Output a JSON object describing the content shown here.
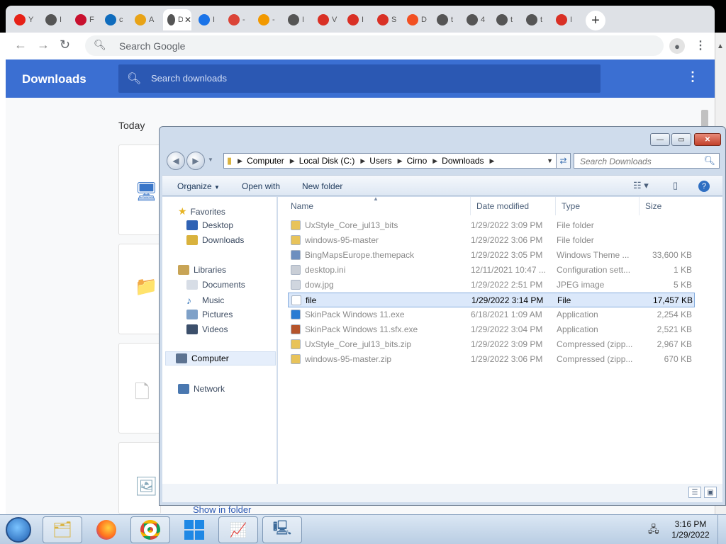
{
  "browser": {
    "tabs": [
      {
        "favicon": "youtube-icon",
        "label": "Y",
        "color": "#e62117"
      },
      {
        "favicon": "globe-icon",
        "label": "I",
        "color": "#555"
      },
      {
        "favicon": "red-logo-icon",
        "label": "F",
        "color": "#c8102e"
      },
      {
        "favicon": "bing-icon",
        "label": "c",
        "color": "#0f6cbd"
      },
      {
        "favicon": "pinwheel-icon",
        "label": "A",
        "color": "#e8a317"
      },
      {
        "favicon": "document-icon",
        "label": "D",
        "color": "#555",
        "active": true
      },
      {
        "favicon": "history-icon",
        "label": "I",
        "color": "#1a73e8"
      },
      {
        "favicon": "chrome-icon",
        "label": "-",
        "color": "#db4437"
      },
      {
        "favicon": "paint-icon",
        "label": "-",
        "color": "#f29900"
      },
      {
        "favicon": "globe-icon",
        "label": "I",
        "color": "#555"
      },
      {
        "favicon": "grid-icon",
        "label": "V",
        "color": "#d93025"
      },
      {
        "favicon": "target-icon",
        "label": "I",
        "color": "#d93025"
      },
      {
        "favicon": "grid-icon",
        "label": "S",
        "color": "#d93025"
      },
      {
        "favicon": "windows-icon",
        "label": "D",
        "color": "#f25022"
      },
      {
        "favicon": "globe-icon",
        "label": "t",
        "color": "#555"
      },
      {
        "favicon": "globe-icon",
        "label": "4",
        "color": "#555"
      },
      {
        "favicon": "globe-icon",
        "label": "t",
        "color": "#555"
      },
      {
        "favicon": "globe-icon",
        "label": "t",
        "color": "#555"
      },
      {
        "favicon": "grid-icon",
        "label": "I",
        "color": "#d93025"
      }
    ],
    "active_tab_close": "✕",
    "new_tab": "+",
    "omnibox_placeholder": "Search Google",
    "downloads_title": "Downloads",
    "downloads_search_placeholder": "Search downloads",
    "today_label": "Today",
    "show_in_folder": "Show in folder"
  },
  "explorer": {
    "address": [
      "Computer",
      "Local Disk (C:)",
      "Users",
      "Cirno",
      "Downloads"
    ],
    "search_placeholder": "Search Downloads",
    "commands": {
      "organize": "Organize",
      "open_with": "Open with",
      "new_folder": "New folder"
    },
    "nav": {
      "favorites": "Favorites",
      "desktop": "Desktop",
      "downloads": "Downloads",
      "libraries": "Libraries",
      "documents": "Documents",
      "music": "Music",
      "pictures": "Pictures",
      "videos": "Videos",
      "computer": "Computer",
      "network": "Network"
    },
    "columns": {
      "name": "Name",
      "date": "Date modified",
      "type": "Type",
      "size": "Size"
    },
    "files": [
      {
        "name": "UxStyle_Core_jul13_bits",
        "date": "1/29/2022 3:09 PM",
        "type": "File folder",
        "size": "",
        "icon": "folder-icon",
        "color": "#e8c35a"
      },
      {
        "name": "windows-95-master",
        "date": "1/29/2022 3:06 PM",
        "type": "File folder",
        "size": "",
        "icon": "folder-icon",
        "color": "#e8c35a"
      },
      {
        "name": "BingMapsEurope.themepack",
        "date": "1/29/2022 3:05 PM",
        "type": "Windows Theme ...",
        "size": "33,600 KB",
        "icon": "theme-file-icon",
        "color": "#6d8fbf"
      },
      {
        "name": "desktop.ini",
        "date": "12/11/2021 10:47 ...",
        "type": "Configuration sett...",
        "size": "1 KB",
        "icon": "settings-file-icon",
        "color": "#c9ced6"
      },
      {
        "name": "dow.jpg",
        "date": "1/29/2022 2:51 PM",
        "type": "JPEG image",
        "size": "5 KB",
        "icon": "image-file-icon",
        "color": "#d0d6df"
      },
      {
        "name": "file",
        "date": "1/29/2022 3:14 PM",
        "type": "File",
        "size": "17,457 KB",
        "icon": "blank-file-icon",
        "color": "#ffffff",
        "selected": true
      },
      {
        "name": "SkinPack Windows 11.exe",
        "date": "6/18/2021 1:09 AM",
        "type": "Application",
        "size": "2,254 KB",
        "icon": "windows-logo-icon",
        "color": "#2b7cd3"
      },
      {
        "name": "SkinPack Windows 11.sfx.exe",
        "date": "1/29/2022 3:04 PM",
        "type": "Application",
        "size": "2,521 KB",
        "icon": "archive-exe-icon",
        "color": "#b5542b"
      },
      {
        "name": "UxStyle_Core_jul13_bits.zip",
        "date": "1/29/2022 3:09 PM",
        "type": "Compressed (zipp...",
        "size": "2,967 KB",
        "icon": "zip-folder-icon",
        "color": "#e8c35a"
      },
      {
        "name": "windows-95-master.zip",
        "date": "1/29/2022 3:06 PM",
        "type": "Compressed (zipp...",
        "size": "670 KB",
        "icon": "zip-folder-icon",
        "color": "#e8c35a"
      }
    ]
  },
  "taskbar": {
    "apps": [
      "explorer-icon",
      "firefox-icon",
      "chrome-icon",
      "windows-tile-icon",
      "task-manager-icon",
      "control-panel-icon"
    ],
    "time": "3:16 PM",
    "date": "1/29/2022"
  }
}
